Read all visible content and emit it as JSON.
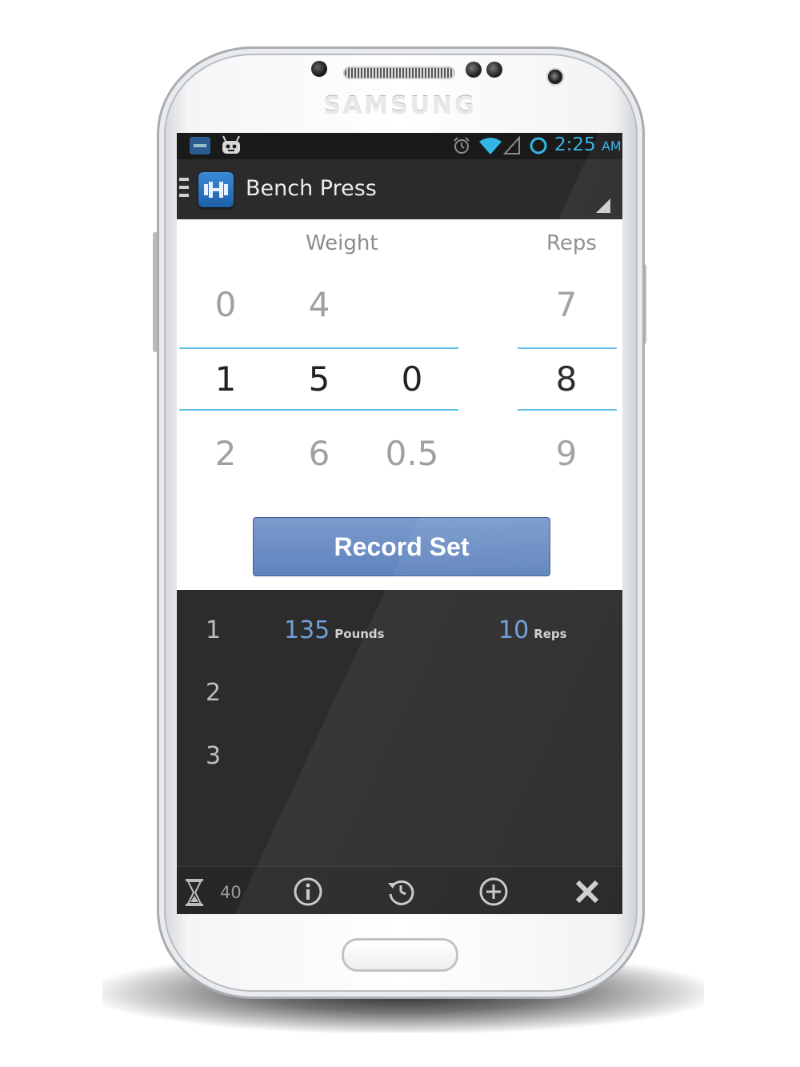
{
  "device": {
    "brand": "SAMSUNG"
  },
  "status_bar": {
    "time": "2:25",
    "ampm": "AM"
  },
  "action_bar": {
    "title": "Bench Press"
  },
  "picker": {
    "weight_label": "Weight",
    "reps_label": "Reps",
    "weight_columns": [
      {
        "above": "0",
        "selected": "1",
        "below": "2"
      },
      {
        "above": "4",
        "selected": "5",
        "below": "6"
      },
      {
        "above": "",
        "selected": "0",
        "below": "0.5"
      }
    ],
    "reps_column": {
      "above": "7",
      "selected": "8",
      "below": "9"
    }
  },
  "record_button": {
    "label": "Record Set"
  },
  "sets": [
    {
      "number": "1",
      "weight": "135",
      "weight_unit": "Pounds",
      "reps": "10",
      "reps_unit": "Reps"
    },
    {
      "number": "2"
    },
    {
      "number": "3"
    }
  ],
  "bottom_bar": {
    "timer": "40",
    "icons": [
      "hourglass-icon",
      "info-icon",
      "history-icon",
      "add-icon",
      "close-icon"
    ]
  },
  "colors": {
    "accent_blue": "#33b5e5",
    "record_button": "#6a8cc4",
    "log_value_blue": "#6f9fd8",
    "dark_background": "#2c2c2c"
  }
}
